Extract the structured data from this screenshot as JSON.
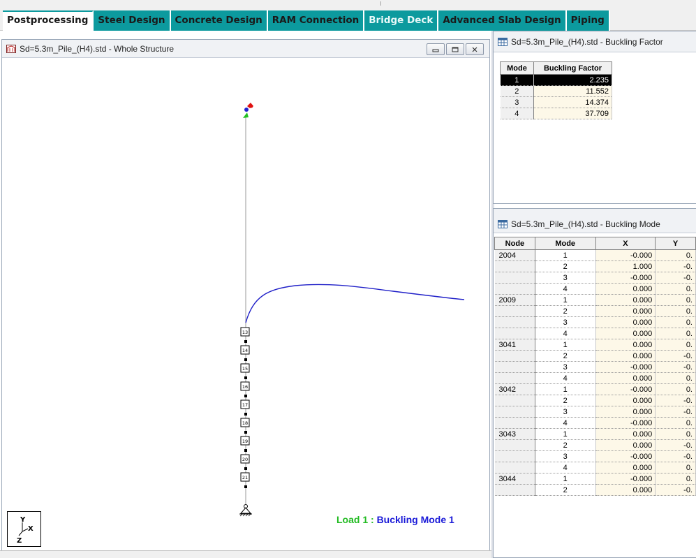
{
  "tabs": [
    {
      "label": "Postprocessing",
      "active": true
    },
    {
      "label": "Steel Design",
      "active": false
    },
    {
      "label": "Concrete Design",
      "active": false
    },
    {
      "label": "RAM Connection",
      "active": false
    },
    {
      "label": "Bridge Deck",
      "active": false,
      "light": true
    },
    {
      "label": "Advanced Slab Design",
      "active": false
    },
    {
      "label": "Piping",
      "active": false
    }
  ],
  "structure_window": {
    "title": "Sd=5.3m_Pile_(H4).std - Whole Structure",
    "icon": "structure-view-icon",
    "controls": [
      "minimize",
      "restore",
      "close"
    ],
    "node_labels": [
      "13",
      "14",
      "15",
      "16",
      "17",
      "18",
      "19",
      "20",
      "21"
    ],
    "axis_labels": {
      "y": "Y",
      "x": "X",
      "z": "Z"
    },
    "load_label_load": "Load 1 : ",
    "load_label_mode": "Buckling Mode 1"
  },
  "factor_window": {
    "title": "Sd=5.3m_Pile_(H4).std - Buckling Factor",
    "icon": "table-icon",
    "headers": [
      "Mode",
      "Buckling Factor"
    ],
    "rows": [
      {
        "mode": "1",
        "factor": "2.235",
        "selected": true
      },
      {
        "mode": "2",
        "factor": "11.552"
      },
      {
        "mode": "3",
        "factor": "14.374"
      },
      {
        "mode": "4",
        "factor": "37.709"
      }
    ]
  },
  "shape_window": {
    "title": "Sd=5.3m_Pile_(H4).std - Buckling Mode",
    "icon": "table-icon",
    "headers": [
      "Node",
      "Mode",
      "X",
      "Y"
    ],
    "rows": [
      {
        "node": "2004",
        "mode": "1",
        "x": "-0.000",
        "y": "0."
      },
      {
        "node": "",
        "mode": "2",
        "x": "1.000",
        "y": "-0."
      },
      {
        "node": "",
        "mode": "3",
        "x": "-0.000",
        "y": "-0."
      },
      {
        "node": "",
        "mode": "4",
        "x": "0.000",
        "y": "0."
      },
      {
        "node": "2009",
        "mode": "1",
        "x": "0.000",
        "y": "0."
      },
      {
        "node": "",
        "mode": "2",
        "x": "0.000",
        "y": "0."
      },
      {
        "node": "",
        "mode": "3",
        "x": "0.000",
        "y": "0."
      },
      {
        "node": "",
        "mode": "4",
        "x": "0.000",
        "y": "0."
      },
      {
        "node": "3041",
        "mode": "1",
        "x": "0.000",
        "y": "0."
      },
      {
        "node": "",
        "mode": "2",
        "x": "0.000",
        "y": "-0."
      },
      {
        "node": "",
        "mode": "3",
        "x": "-0.000",
        "y": "-0."
      },
      {
        "node": "",
        "mode": "4",
        "x": "0.000",
        "y": "0."
      },
      {
        "node": "3042",
        "mode": "1",
        "x": "-0.000",
        "y": "0."
      },
      {
        "node": "",
        "mode": "2",
        "x": "0.000",
        "y": "-0."
      },
      {
        "node": "",
        "mode": "3",
        "x": "0.000",
        "y": "-0."
      },
      {
        "node": "",
        "mode": "4",
        "x": "-0.000",
        "y": "0."
      },
      {
        "node": "3043",
        "mode": "1",
        "x": "0.000",
        "y": "0."
      },
      {
        "node": "",
        "mode": "2",
        "x": "0.000",
        "y": "-0."
      },
      {
        "node": "",
        "mode": "3",
        "x": "-0.000",
        "y": "-0."
      },
      {
        "node": "",
        "mode": "4",
        "x": "0.000",
        "y": "0."
      },
      {
        "node": "3044",
        "mode": "1",
        "x": "-0.000",
        "y": "0."
      },
      {
        "node": "",
        "mode": "2",
        "x": "0.000",
        "y": "-0."
      }
    ]
  },
  "colors": {
    "tab_accent": "#0c9a9e",
    "mode_shape": "#2020c8",
    "load_text": "#22bb22",
    "mode_text": "#1a1ad8",
    "cell_bg": "#fdf8e8"
  }
}
